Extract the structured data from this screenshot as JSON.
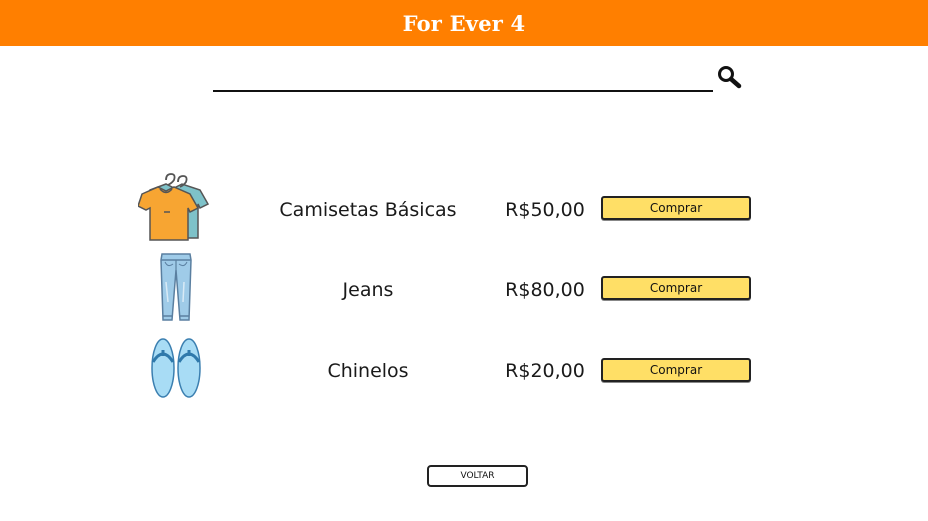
{
  "header": {
    "title": "For Ever 4",
    "background": "#ff7f00"
  },
  "search": {
    "value": "",
    "icon": "search-icon"
  },
  "products": [
    {
      "name": "Camisetas Básicas",
      "price": "R$50,00",
      "buy_label": "Comprar",
      "icon": "tshirt-icon"
    },
    {
      "name": "Jeans",
      "price": "R$80,00",
      "buy_label": "Comprar",
      "icon": "jeans-icon"
    },
    {
      "name": "Chinelos",
      "price": "R$20,00",
      "buy_label": "Comprar",
      "icon": "flip-flops-icon"
    }
  ],
  "buy_button_color": "#ffdf66",
  "back_label": "VOLTAR"
}
